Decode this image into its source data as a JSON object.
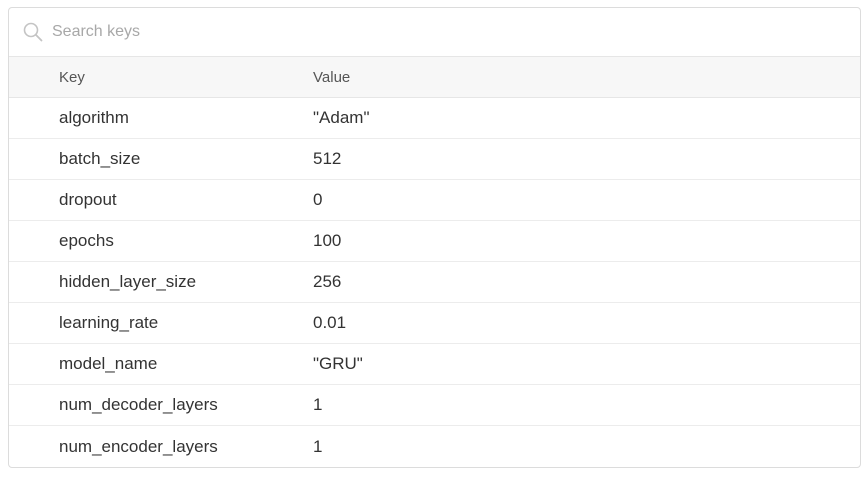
{
  "search": {
    "placeholder": "Search keys",
    "value": ""
  },
  "table": {
    "headers": {
      "key": "Key",
      "value": "Value"
    },
    "rows": [
      {
        "key": "algorithm",
        "value": "\"Adam\""
      },
      {
        "key": "batch_size",
        "value": "512"
      },
      {
        "key": "dropout",
        "value": "0"
      },
      {
        "key": "epochs",
        "value": "100"
      },
      {
        "key": "hidden_layer_size",
        "value": "256"
      },
      {
        "key": "learning_rate",
        "value": "0.01"
      },
      {
        "key": "model_name",
        "value": "\"GRU\""
      },
      {
        "key": "num_decoder_layers",
        "value": "1"
      },
      {
        "key": "num_encoder_layers",
        "value": "1"
      }
    ]
  },
  "icons": {
    "search": "search-icon"
  },
  "colors": {
    "border": "#dcdcdc",
    "header_bg": "#f7f7f7",
    "placeholder": "#a8a8a8",
    "text": "#333333"
  }
}
